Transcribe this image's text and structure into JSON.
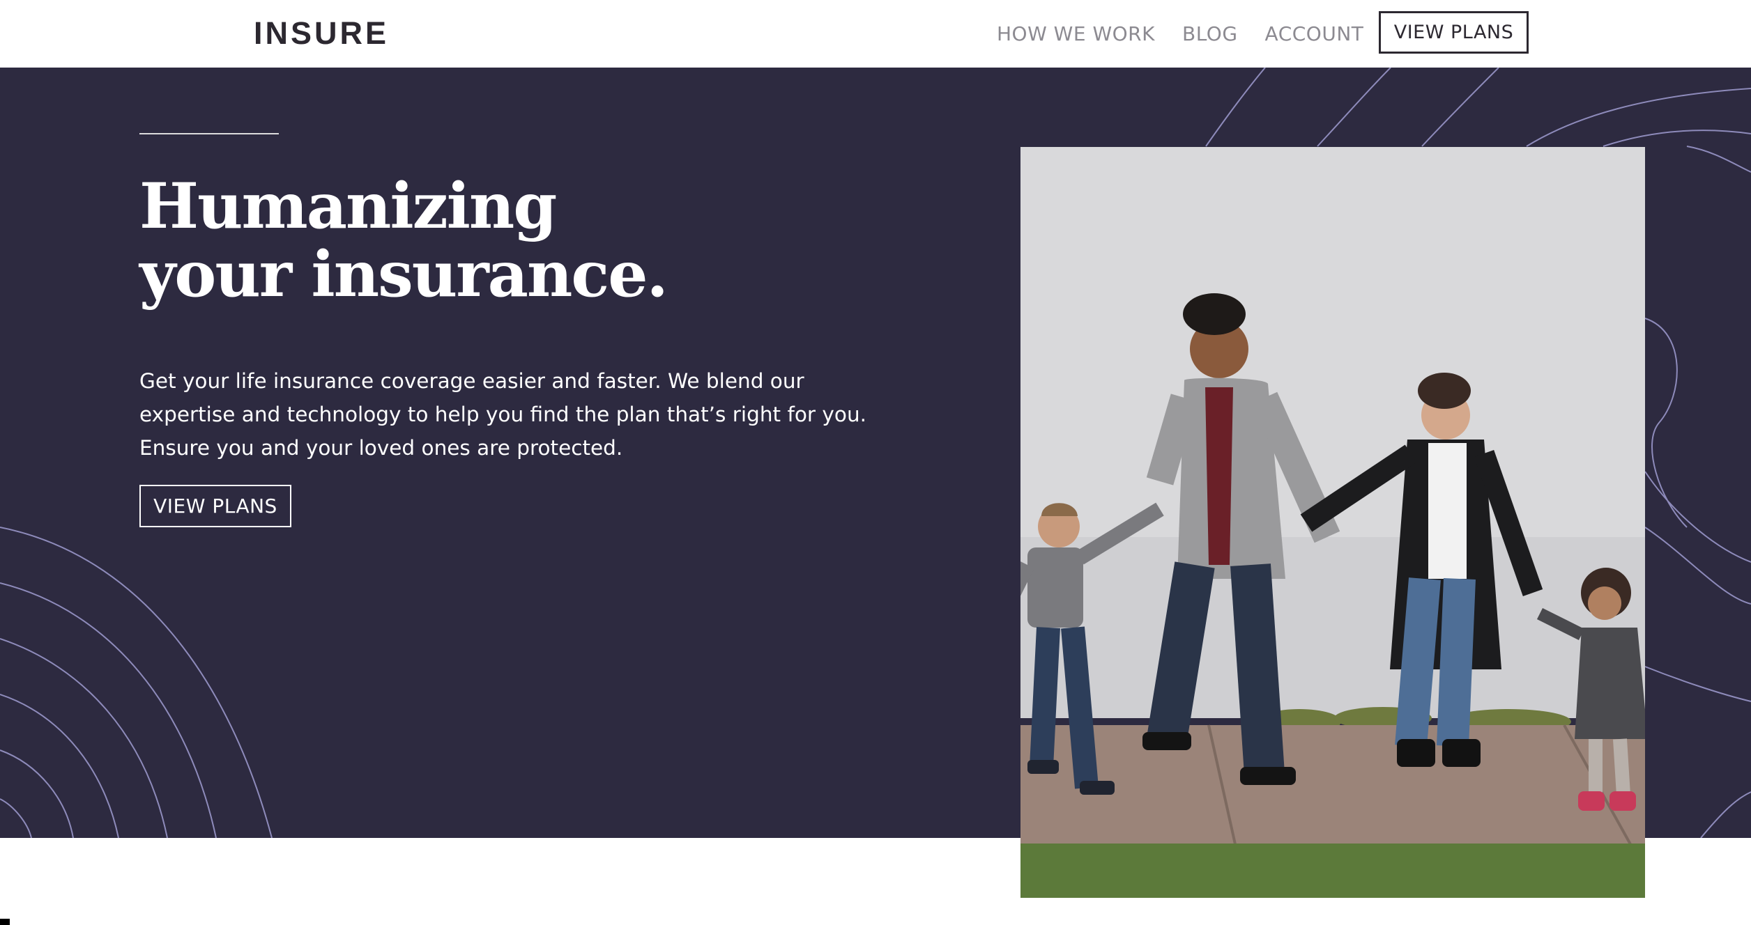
{
  "nav": {
    "logo": "INSURE",
    "links": [
      "HOW WE WORK",
      "BLOG",
      "ACCOUNT"
    ],
    "cta": "VIEW PLANS"
  },
  "hero": {
    "title_line1": "Humanizing",
    "title_line2": "your insurance.",
    "description": "Get your life insurance coverage easier and faster. We blend our expertise and technology to help you find the plan that’s right for you. Ensure you and your loved ones are protected.",
    "cta": "VIEW PLANS"
  },
  "colors": {
    "hero_background": "#2d2a40",
    "primary_text": "#2c2830",
    "nav_link": "#8c8a91",
    "pattern_line": "#8e8bbb"
  }
}
